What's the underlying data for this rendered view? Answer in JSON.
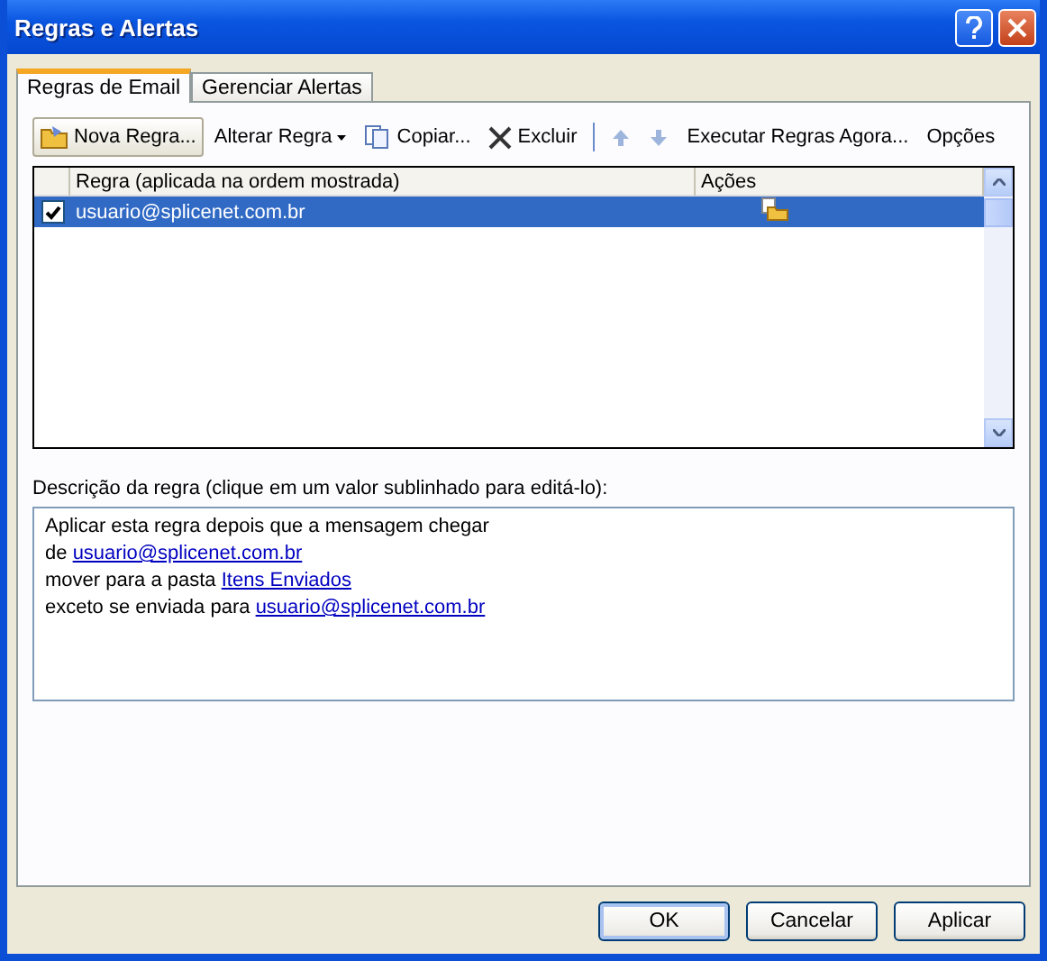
{
  "window": {
    "title": "Regras e Alertas"
  },
  "tabs": [
    {
      "label": "Regras de Email",
      "selected": true
    },
    {
      "label": "Gerenciar Alertas",
      "selected": false
    }
  ],
  "toolbar": [
    {
      "kind": "new",
      "label": "Nova Regra..."
    },
    {
      "kind": "dropdown",
      "label": "Alterar Regra"
    },
    {
      "kind": "copy",
      "label": "Copiar..."
    },
    {
      "kind": "delete",
      "label": "Excluir"
    },
    {
      "kind": "separator"
    },
    {
      "kind": "up"
    },
    {
      "kind": "down"
    },
    {
      "kind": "button",
      "label": "Executar Regras Agora..."
    },
    {
      "kind": "button",
      "label": "Opções"
    }
  ],
  "table": {
    "columns": [
      "Regra (aplicada na ordem mostrada)",
      "Ações"
    ],
    "rows": [
      {
        "checked": true,
        "selected": true,
        "rule": "usuario@splicenet.com.br"
      }
    ]
  },
  "description": {
    "label": "Descrição da regra (clique em um valor sublinhado para editá-lo):",
    "lines": [
      {
        "text": "Aplicar esta regra depois que a mensagem chegar"
      },
      {
        "text": "de",
        "link": "usuario@splicenet.com.br"
      },
      {
        "text": "mover para a pasta",
        "link": "Itens Enviados"
      },
      {
        "text": "exceto se enviada para",
        "link": "usuario@splicenet.com.br"
      }
    ]
  },
  "buttons": [
    {
      "label": "OK",
      "default": true
    },
    {
      "label": "Cancelar",
      "default": false
    },
    {
      "label": "Aplicar",
      "default": false
    }
  ]
}
